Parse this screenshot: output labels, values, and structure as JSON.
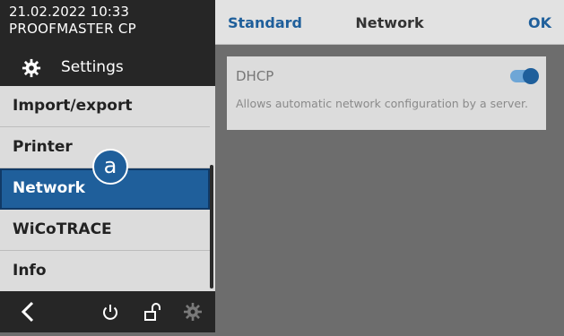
{
  "status": {
    "datetime": "21.02.2022 10:33",
    "device": "PROOFMASTER CP"
  },
  "sidebar": {
    "header": {
      "icon": "gear-icon",
      "label": "Settings"
    },
    "items": [
      {
        "label": "Import/export"
      },
      {
        "label": "Printer"
      },
      {
        "label": "Network",
        "active": true
      },
      {
        "label": "WiCoTRACE"
      },
      {
        "label": "Info"
      }
    ],
    "marker": "a",
    "bottom_icons": [
      "back-chevron-icon",
      "power-icon",
      "unlock-icon",
      "gear-icon"
    ]
  },
  "header": {
    "left_action": "Standard",
    "title": "Network",
    "right_action": "OK"
  },
  "dhcp": {
    "title": "DHCP",
    "description": "Allows automatic network configuration by a server.",
    "enabled": true
  },
  "colors": {
    "accent": "#1f5f9b",
    "dark": "#262626",
    "panel": "#dcdcdc",
    "background": "#6d6d6d"
  }
}
